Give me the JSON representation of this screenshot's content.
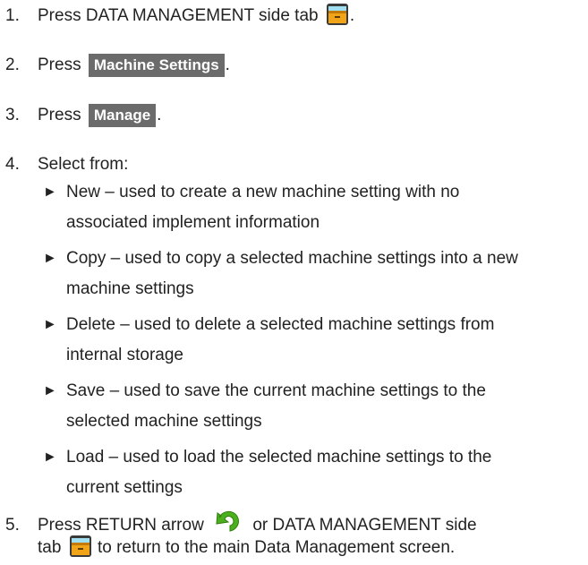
{
  "steps": [
    {
      "number": "1.",
      "before": "Press DATA MANAGEMENT side tab ",
      "icon": "data-management-tab-icon",
      "after": "."
    },
    {
      "number": "2.",
      "before": "Press ",
      "button": "Machine Settings",
      "after": "."
    },
    {
      "number": "3.",
      "before": "Press ",
      "button": "Manage",
      "after": "."
    },
    {
      "number": "4.",
      "text": "Select from:"
    },
    {
      "number": "5.",
      "line1_before": "Press RETURN arrow ",
      "return_icon": "return-arrow-icon",
      "line1_after": " or DATA MANAGEMENT side",
      "line2_before": "tab ",
      "tab_icon": "data-management-tab-icon",
      "line2_after": " to return to the main Data Management screen."
    }
  ],
  "options": [
    {
      "line1": "New – used to create a new machine setting with no",
      "line2": "associated implement information"
    },
    {
      "line1": "Copy – used to copy a selected machine settings into a new",
      "line2": "machine settings"
    },
    {
      "line1": "Delete – used to delete a selected machine settings from",
      "line2": "internal storage"
    },
    {
      "line1": "Save – used to save the current machine settings to the",
      "line2": "selected machine settings"
    },
    {
      "line1": "Load – used to load the selected machine settings to the",
      "line2": "current settings"
    }
  ],
  "bullet_glyph": "►",
  "colors": {
    "text": "#222222",
    "button_bg": "#6b6b6b",
    "button_text": "#ffffff",
    "folder_orange": "#f2a418",
    "return_green": "#4caf1e"
  }
}
